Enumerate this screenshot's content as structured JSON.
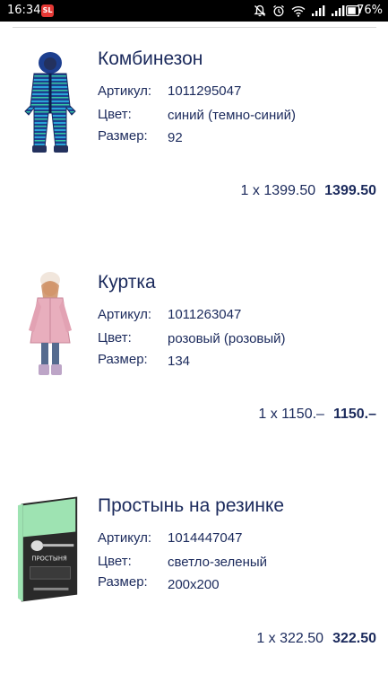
{
  "status_bar": {
    "time": "16:34",
    "app_badge": "SL",
    "battery_percent": "76%"
  },
  "items": [
    {
      "title": "Комбинезон",
      "article_label": "Артикул:",
      "article": "1011295047",
      "color_label": "Цвет:",
      "color": "синий (темно-синий)",
      "size_label": "Размер:",
      "size": "92",
      "qty_price": "1 x 1399.50",
      "total": "1399.50"
    },
    {
      "title": "Куртка",
      "article_label": "Артикул:",
      "article": "1011263047",
      "color_label": "Цвет:",
      "color": "розовый (розовый)",
      "size_label": "Размер:",
      "size": "134",
      "qty_price": "1 x 1150.–",
      "total": "1150.–"
    },
    {
      "title": "Простынь на резинке",
      "article_label": "Артикул:",
      "article": "1014447047",
      "color_label": "Цвет:",
      "color": "светло-зеленый",
      "size_label": "Размер:",
      "size": "200x200",
      "qty_price": "1 x 322.50",
      "total": "322.50",
      "package_text": "ПРОСТЫНЯ"
    }
  ]
}
